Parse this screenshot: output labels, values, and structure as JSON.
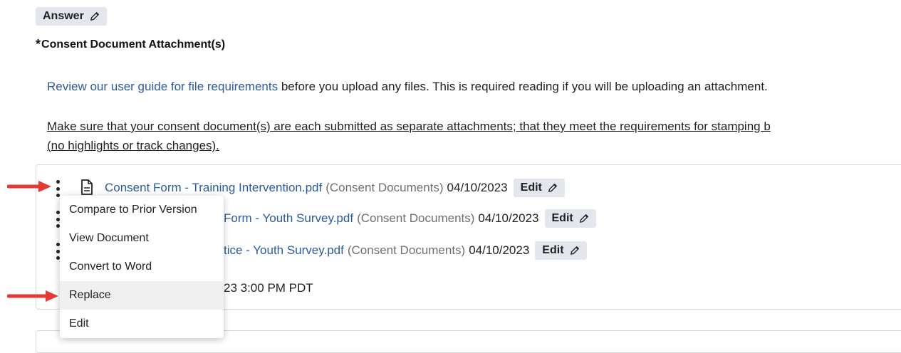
{
  "answer_chip": {
    "label": "Answer"
  },
  "question": {
    "required_mark": "*",
    "label": "Consent Document Attachment(s)"
  },
  "guide": {
    "link_text": "Review our user guide for file requirements",
    "rest_text": " before you upload any files. This is required reading if you will be uploading an attachment."
  },
  "note": {
    "line1": "Make sure that your consent document(s) are each submitted as separate attachments; that they meet the requirements for stamping b",
    "line2": "(no highlights or track changes)."
  },
  "attachments": [
    {
      "visible_name": "Consent Form - Training Intervention.pdf",
      "category": "(Consent Documents)",
      "date": "04/10/2023",
      "edit_label": "Edit"
    },
    {
      "visible_name": "Form - Youth Survey.pdf",
      "category": "(Consent Documents)",
      "date": "04/10/2023",
      "edit_label": "Edit"
    },
    {
      "visible_name": "tice - Youth Survey.pdf",
      "category": "(Consent Documents)",
      "date": "04/10/2023",
      "edit_label": "Edit"
    }
  ],
  "last_updated_partial": "23 3:00 PM PDT",
  "context_menu": {
    "items": [
      "Compare to Prior Version",
      "View Document",
      "Convert to Word",
      "Replace",
      "Edit"
    ],
    "highlighted": "Replace"
  },
  "colors": {
    "link": "#2a5aa0",
    "chip_bg": "#e3e6ec",
    "annotation_arrow": "#e53935",
    "menu_hover": "#f0f0f0"
  },
  "icons": [
    "pencil-icon",
    "kebab-menu-icon",
    "document-icon",
    "red-arrow-annotation"
  ]
}
